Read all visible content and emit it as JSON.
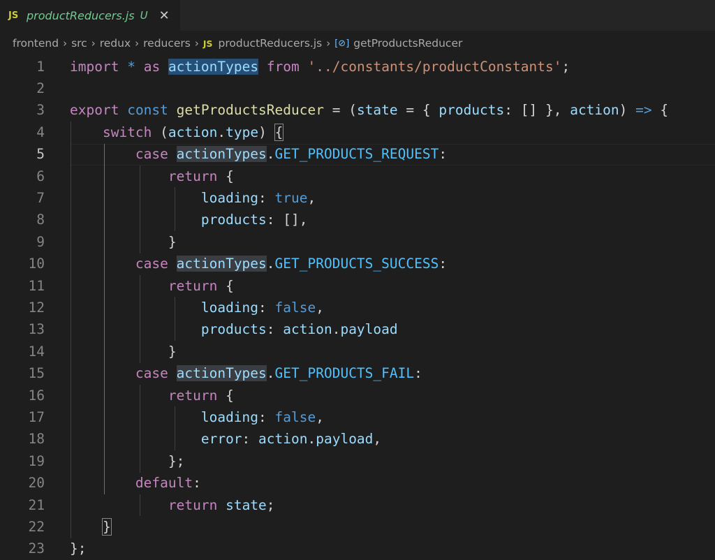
{
  "tab": {
    "js_label": "JS",
    "filename": "productReducers.js",
    "status": "U",
    "close": "✕"
  },
  "breadcrumb": {
    "items": [
      "frontend",
      "src",
      "redux",
      "reducers"
    ],
    "file_js": "JS",
    "file": "productReducers.js",
    "symbol_icon": "[⊘]",
    "symbol": "getProductsReducer"
  },
  "editor": {
    "active_line": 5,
    "lines": [
      [
        {
          "t": "import",
          "c": "k"
        },
        {
          "t": " "
        },
        {
          "t": "*",
          "c": "s"
        },
        {
          "t": " "
        },
        {
          "t": "as",
          "c": "k"
        },
        {
          "t": " "
        },
        {
          "t": "actionTypes",
          "c": "v",
          "x": "hl2"
        },
        {
          "t": " "
        },
        {
          "t": "from",
          "c": "k"
        },
        {
          "t": " "
        },
        {
          "t": "'../constants/productConstants'",
          "c": "str"
        },
        {
          "t": ";"
        }
      ],
      [],
      [
        {
          "t": "export",
          "c": "k"
        },
        {
          "t": " "
        },
        {
          "t": "const",
          "c": "s"
        },
        {
          "t": " "
        },
        {
          "t": "getProductsReducer",
          "c": "f"
        },
        {
          "t": " = ("
        },
        {
          "t": "state",
          "c": "v"
        },
        {
          "t": " = { "
        },
        {
          "t": "products",
          "c": "v"
        },
        {
          "t": ": [] }, "
        },
        {
          "t": "action",
          "c": "v"
        },
        {
          "t": ") "
        },
        {
          "t": "=>",
          "c": "s"
        },
        {
          "t": " {"
        }
      ],
      [
        {
          "t": "    "
        },
        {
          "t": "switch",
          "c": "k"
        },
        {
          "t": " ("
        },
        {
          "t": "action",
          "c": "v"
        },
        {
          "t": "."
        },
        {
          "t": "type",
          "c": "v"
        },
        {
          "t": ") "
        },
        {
          "t": "{",
          "x": "bm"
        }
      ],
      [
        {
          "t": "        "
        },
        {
          "t": "case",
          "c": "k"
        },
        {
          "t": " "
        },
        {
          "t": "actionTypes",
          "c": "v",
          "x": "hl"
        },
        {
          "t": "."
        },
        {
          "t": "GET_PRODUCTS_REQUEST",
          "c": "c"
        },
        {
          "t": ":"
        }
      ],
      [
        {
          "t": "            "
        },
        {
          "t": "return",
          "c": "k"
        },
        {
          "t": " {"
        }
      ],
      [
        {
          "t": "                "
        },
        {
          "t": "loading",
          "c": "v"
        },
        {
          "t": ": "
        },
        {
          "t": "true",
          "c": "s"
        },
        {
          "t": ","
        }
      ],
      [
        {
          "t": "                "
        },
        {
          "t": "products",
          "c": "v"
        },
        {
          "t": ": [],"
        }
      ],
      [
        {
          "t": "            }"
        }
      ],
      [
        {
          "t": "        "
        },
        {
          "t": "case",
          "c": "k"
        },
        {
          "t": " "
        },
        {
          "t": "actionTypes",
          "c": "v",
          "x": "hl"
        },
        {
          "t": "."
        },
        {
          "t": "GET_PRODUCTS_SUCCESS",
          "c": "c"
        },
        {
          "t": ":"
        }
      ],
      [
        {
          "t": "            "
        },
        {
          "t": "return",
          "c": "k"
        },
        {
          "t": " {"
        }
      ],
      [
        {
          "t": "                "
        },
        {
          "t": "loading",
          "c": "v"
        },
        {
          "t": ": "
        },
        {
          "t": "false",
          "c": "s"
        },
        {
          "t": ","
        }
      ],
      [
        {
          "t": "                "
        },
        {
          "t": "products",
          "c": "v"
        },
        {
          "t": ": "
        },
        {
          "t": "action",
          "c": "v"
        },
        {
          "t": "."
        },
        {
          "t": "payload",
          "c": "v"
        }
      ],
      [
        {
          "t": "            }"
        }
      ],
      [
        {
          "t": "        "
        },
        {
          "t": "case",
          "c": "k"
        },
        {
          "t": " "
        },
        {
          "t": "actionTypes",
          "c": "v",
          "x": "hl"
        },
        {
          "t": "."
        },
        {
          "t": "GET_PRODUCTS_FAIL",
          "c": "c"
        },
        {
          "t": ":"
        }
      ],
      [
        {
          "t": "            "
        },
        {
          "t": "return",
          "c": "k"
        },
        {
          "t": " {"
        }
      ],
      [
        {
          "t": "                "
        },
        {
          "t": "loading",
          "c": "v"
        },
        {
          "t": ": "
        },
        {
          "t": "false",
          "c": "s"
        },
        {
          "t": ","
        }
      ],
      [
        {
          "t": "                "
        },
        {
          "t": "error",
          "c": "v"
        },
        {
          "t": ": "
        },
        {
          "t": "action",
          "c": "v"
        },
        {
          "t": "."
        },
        {
          "t": "payload",
          "c": "v"
        },
        {
          "t": ","
        }
      ],
      [
        {
          "t": "            };"
        }
      ],
      [
        {
          "t": "        "
        },
        {
          "t": "default",
          "c": "k"
        },
        {
          "t": ":"
        }
      ],
      [
        {
          "t": "            "
        },
        {
          "t": "return",
          "c": "k"
        },
        {
          "t": " "
        },
        {
          "t": "state",
          "c": "v"
        },
        {
          "t": ";"
        }
      ],
      [
        {
          "t": "    "
        },
        {
          "t": "}",
          "x": "bm"
        }
      ],
      [
        {
          "t": "};"
        }
      ]
    ]
  }
}
